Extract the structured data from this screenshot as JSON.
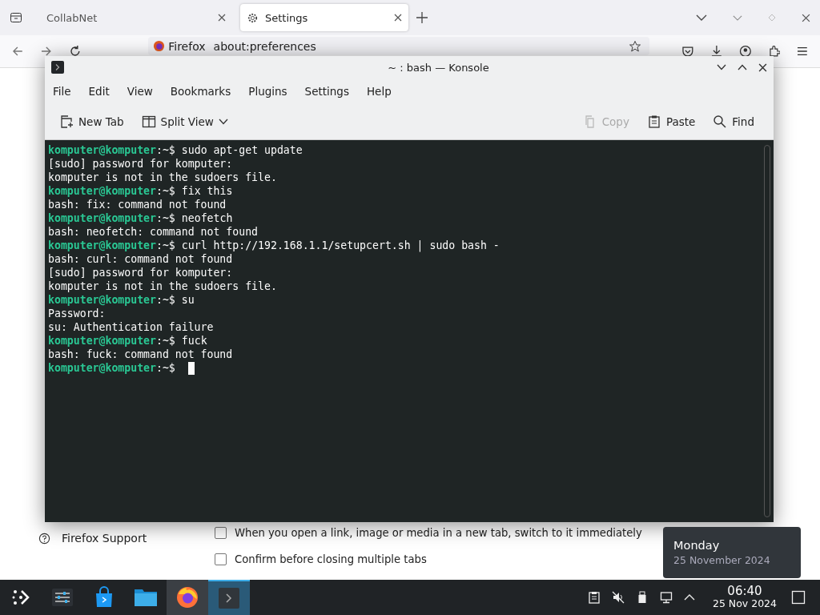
{
  "browser": {
    "tabs": [
      {
        "label": "CollabNet",
        "selected": false,
        "kind": "page"
      },
      {
        "label": "Settings",
        "selected": true,
        "kind": "settings"
      }
    ],
    "identity": "Firefox",
    "url": "about:preferences",
    "sidebar": [
      {
        "label": "Firefox Support"
      }
    ],
    "options": [
      {
        "label": "When you open a link, image or media in a new tab, switch to it immediately",
        "checked": false
      },
      {
        "label": "Confirm before closing multiple tabs",
        "checked": false
      }
    ]
  },
  "konsole": {
    "title": "~ : bash — Konsole",
    "menu": [
      "File",
      "Edit",
      "View",
      "Bookmarks",
      "Plugins",
      "Settings",
      "Help"
    ],
    "toolbar": [
      {
        "label": "New Tab",
        "kind": "newtab",
        "disabled": false
      },
      {
        "label": "Split View",
        "kind": "split",
        "disabled": false
      },
      {
        "label": "Copy",
        "kind": "copy",
        "disabled": true
      },
      {
        "label": "Paste",
        "kind": "paste",
        "disabled": false
      },
      {
        "label": "Find",
        "kind": "find",
        "disabled": false
      }
    ],
    "lines": [
      {
        "kind": "prompt",
        "user": "komputer@komputer",
        "location": ":~$",
        "command": "sudo apt-get update"
      },
      {
        "kind": "output",
        "text": "[sudo] password for komputer:"
      },
      {
        "kind": "output",
        "text": "komputer is not in the sudoers file."
      },
      {
        "kind": "prompt",
        "user": "komputer@komputer",
        "location": ":~$",
        "command": "fix this"
      },
      {
        "kind": "output",
        "text": "bash: fix: command not found"
      },
      {
        "kind": "prompt",
        "user": "komputer@komputer",
        "location": ":~$",
        "command": "neofetch"
      },
      {
        "kind": "output",
        "text": "bash: neofetch: command not found"
      },
      {
        "kind": "prompt",
        "user": "komputer@komputer",
        "location": ":~$",
        "command": "curl http://192.168.1.1/setupcert.sh | sudo bash -"
      },
      {
        "kind": "output",
        "text": "bash: curl: command not found"
      },
      {
        "kind": "output",
        "text": "[sudo] password for komputer:"
      },
      {
        "kind": "output",
        "text": "komputer is not in the sudoers file."
      },
      {
        "kind": "prompt",
        "user": "komputer@komputer",
        "location": ":~$",
        "command": "su"
      },
      {
        "kind": "output",
        "text": "Password:"
      },
      {
        "kind": "output",
        "text": "su: Authentication failure"
      },
      {
        "kind": "prompt",
        "user": "komputer@komputer",
        "location": ":~$",
        "command": "fuck"
      },
      {
        "kind": "output",
        "text": "bash: fuck: command not found"
      },
      {
        "kind": "prompt",
        "user": "komputer@komputer",
        "location": ":~$",
        "cursor": true
      }
    ]
  },
  "taskbar": {
    "apps": [
      {
        "kind": "launcher",
        "selected": false
      },
      {
        "kind": "settings",
        "selected": false
      },
      {
        "kind": "store",
        "selected": false
      },
      {
        "kind": "files",
        "selected": false
      },
      {
        "kind": "browser",
        "selected": false,
        "hovered": true
      },
      {
        "kind": "terminal",
        "selected": true
      }
    ],
    "tray": [
      {
        "kind": "clipboard"
      },
      {
        "kind": "muted"
      },
      {
        "kind": "usb"
      },
      {
        "kind": "network"
      },
      {
        "kind": "expand"
      }
    ],
    "time": "06:40",
    "date": "25 Nov 2024"
  },
  "tooltip": {
    "day": "Monday",
    "date": "25 November 2024"
  }
}
